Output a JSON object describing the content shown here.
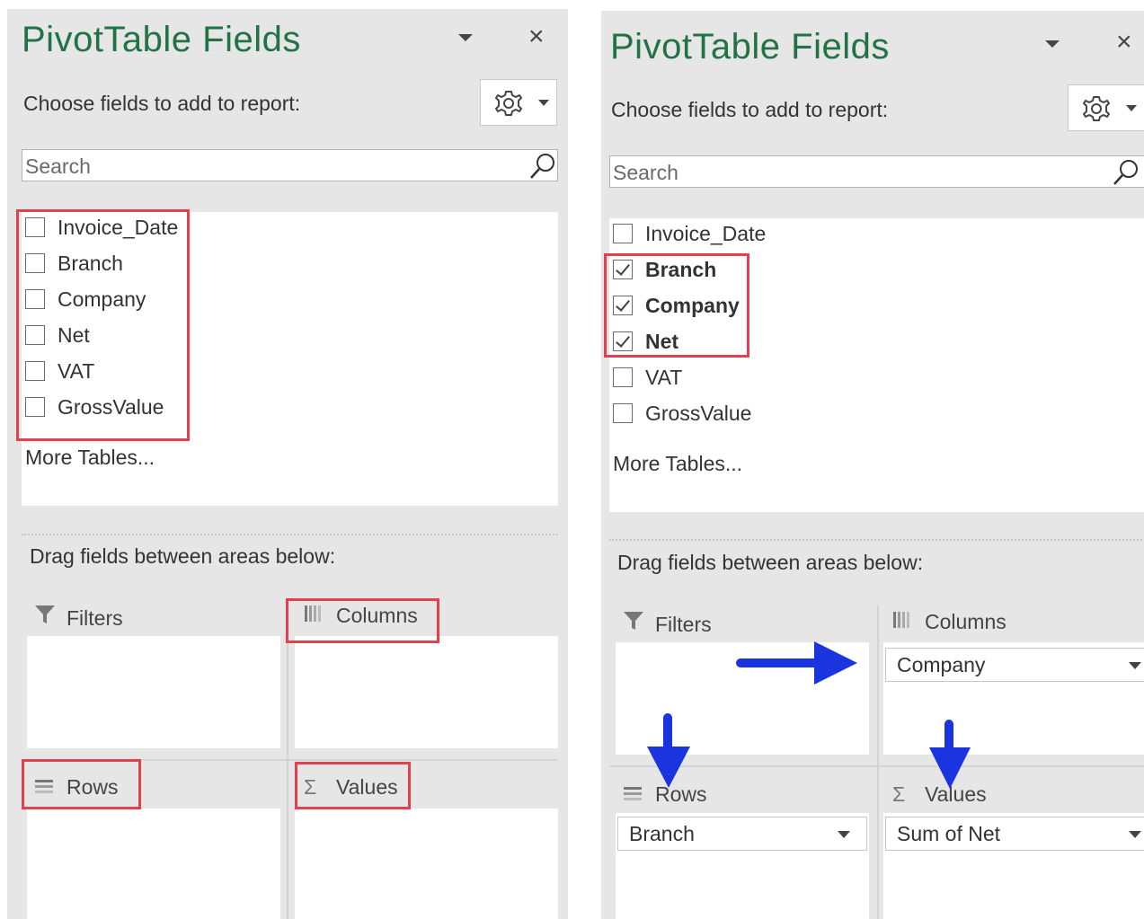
{
  "left_panel": {
    "title": "PivotTable Fields",
    "choose_label": "Choose fields to add to report:",
    "search_placeholder": "Search",
    "fields": [
      {
        "label": "Invoice_Date",
        "checked": false
      },
      {
        "label": "Branch",
        "checked": false
      },
      {
        "label": "Company",
        "checked": false
      },
      {
        "label": "Net",
        "checked": false
      },
      {
        "label": "VAT",
        "checked": false
      },
      {
        "label": "GrossValue",
        "checked": false
      }
    ],
    "more_tables": "More Tables...",
    "drag_label": "Drag fields between areas below:",
    "areas": {
      "filters": "Filters",
      "columns": "Columns",
      "rows": "Rows",
      "values": "Values"
    }
  },
  "right_panel": {
    "title": "PivotTable Fields",
    "choose_label": "Choose fields to add to report:",
    "search_placeholder": "Search",
    "fields": [
      {
        "label": "Invoice_Date",
        "checked": false
      },
      {
        "label": "Branch",
        "checked": true
      },
      {
        "label": "Company",
        "checked": true
      },
      {
        "label": "Net",
        "checked": true
      },
      {
        "label": "VAT",
        "checked": false
      },
      {
        "label": "GrossValue",
        "checked": false
      }
    ],
    "more_tables": "More Tables...",
    "drag_label": "Drag fields between areas below:",
    "areas": {
      "filters": "Filters",
      "columns": "Columns",
      "rows": "Rows",
      "values": "Values"
    },
    "columns_item": "Company",
    "rows_item": "Branch",
    "values_item": "Sum of Net"
  },
  "icons": {
    "close": "×",
    "gear": "gear-icon",
    "search": "search-icon",
    "filter": "filter-icon",
    "sigma": "Σ"
  },
  "colors": {
    "title_green": "#217346",
    "highlight_red": "#e2404d",
    "arrow_blue": "#1a34e0"
  }
}
